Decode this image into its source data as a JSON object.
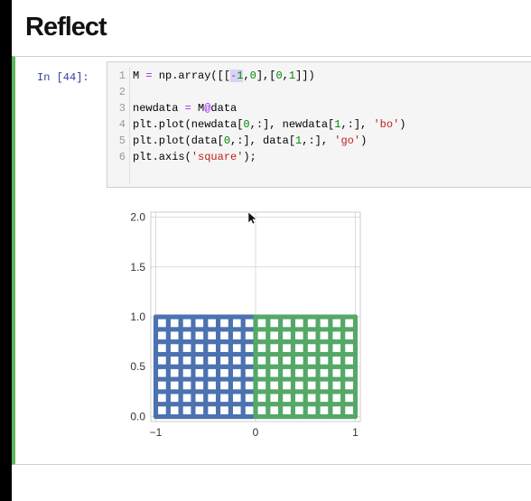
{
  "heading": "Reflect",
  "cell": {
    "prompt": "In [44]:",
    "lines": [
      {
        "n": "1",
        "t": "M = np.array([[-1,0],[0,1]])"
      },
      {
        "n": "2",
        "t": ""
      },
      {
        "n": "3",
        "t": "newdata = M@data"
      },
      {
        "n": "4",
        "t": "plt.plot(newdata[0,:], newdata[1,:], 'bo')"
      },
      {
        "n": "5",
        "t": "plt.plot(data[0,:], data[1,:], 'go')"
      },
      {
        "n": "6",
        "t": "plt.axis('square');"
      }
    ]
  },
  "colors": {
    "blue": "#4c72b0",
    "green": "#55a868",
    "cell_border": "#5cb85c"
  },
  "chart_data": {
    "type": "scatter",
    "title": "",
    "xlabel": "",
    "ylabel": "",
    "xlim": [
      -1.05,
      1.05
    ],
    "ylim": [
      -0.05,
      2.05
    ],
    "xticks": [
      "−1",
      "0",
      "1"
    ],
    "yticks": [
      "0.0",
      "0.5",
      "1.0",
      "1.5",
      "2.0"
    ],
    "xtick_values": [
      -1,
      0,
      1
    ],
    "ytick_values": [
      0.0,
      0.5,
      1.0,
      1.5,
      2.0
    ],
    "grid": true,
    "series": [
      {
        "color": "#4c72b0",
        "marker": "bo",
        "x_range": [
          -1,
          0
        ],
        "y_range": [
          0,
          1
        ],
        "grid_lines": 9
      },
      {
        "color": "#55a868",
        "marker": "go",
        "x_range": [
          0,
          1
        ],
        "y_range": [
          0,
          1
        ],
        "grid_lines": 9
      }
    ]
  }
}
